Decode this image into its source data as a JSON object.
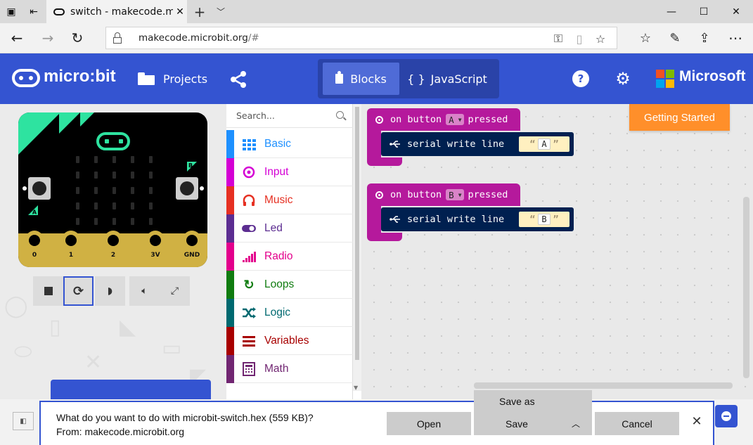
{
  "browser": {
    "tab_title": "switch - makecode.micr",
    "url_host": "makecode.microbit.org",
    "url_path": "/#"
  },
  "header": {
    "logo_text": "micro:bit",
    "projects_label": "Projects",
    "blocks_label": "Blocks",
    "javascript_label": "JavaScript",
    "microsoft_label": "Microsoft",
    "active_editor": "Blocks"
  },
  "simulator": {
    "pin_labels": [
      "0",
      "1",
      "2",
      "3V",
      "GND"
    ],
    "button_labels": [
      "A",
      "B"
    ],
    "controls": [
      "stop",
      "restart",
      "slow-mo",
      "mute",
      "fullscreen"
    ]
  },
  "toolbox": {
    "search_placeholder": "Search...",
    "categories": [
      {
        "label": "Basic",
        "color": "#1e90ff",
        "icon": "grid-icon"
      },
      {
        "label": "Input",
        "color": "#d400d4",
        "icon": "target-icon"
      },
      {
        "label": "Music",
        "color": "#e63022",
        "icon": "headphones-icon"
      },
      {
        "label": "Led",
        "color": "#5c2d91",
        "icon": "toggle-icon"
      },
      {
        "label": "Radio",
        "color": "#e3008c",
        "icon": "signal-bars-icon"
      },
      {
        "label": "Loops",
        "color": "#107c10",
        "icon": "refresh-icon"
      },
      {
        "label": "Logic",
        "color": "#006970",
        "icon": "shuffle-icon"
      },
      {
        "label": "Variables",
        "color": "#a80000",
        "icon": "list-icon"
      },
      {
        "label": "Math",
        "color": "#712672",
        "icon": "calculator-icon"
      }
    ]
  },
  "workspace": {
    "getting_started_label": "Getting Started",
    "blocks": [
      {
        "event_prefix": "on button",
        "button": "A",
        "event_suffix": "pressed",
        "statement": "serial write line",
        "string": "A"
      },
      {
        "event_prefix": "on button",
        "button": "B",
        "event_suffix": "pressed",
        "statement": "serial write line",
        "string": "B"
      }
    ]
  },
  "download": {
    "question": "What do you want to do with microbit-switch.hex (559 KB)?",
    "from": "From: makecode.microbit.org",
    "open_label": "Open",
    "save_label": "Save",
    "save_as_label": "Save as",
    "cancel_label": "Cancel"
  }
}
